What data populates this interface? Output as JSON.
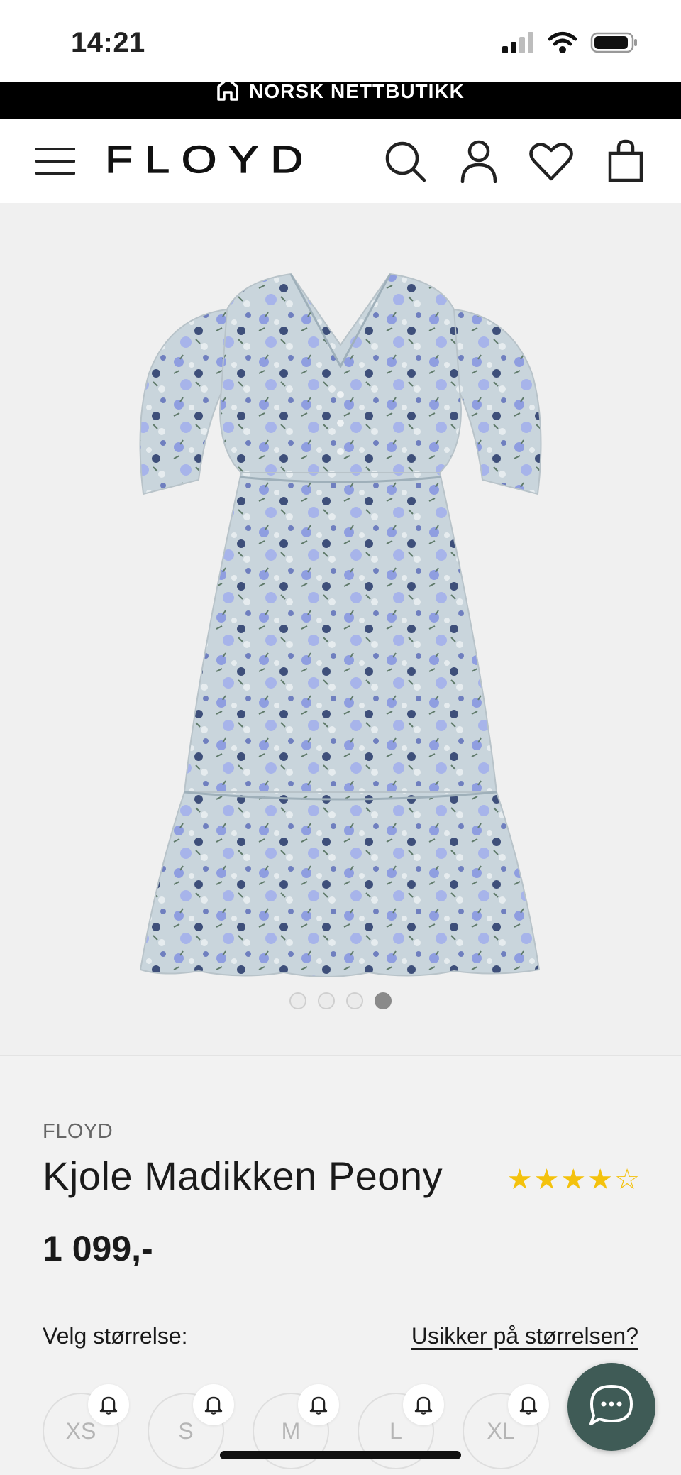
{
  "status_bar": {
    "time": "14:21",
    "icons": [
      "signal-icon",
      "wifi-icon",
      "battery-icon"
    ]
  },
  "promo": {
    "text": "NORSK NETTBUTIKK",
    "icon": "house-icon"
  },
  "header": {
    "logo_text": "FLOYD",
    "icons": [
      "menu-icon",
      "search-icon",
      "user-icon",
      "heart-icon",
      "bag-icon"
    ]
  },
  "gallery": {
    "image": "floral-dress-image",
    "slide_count": 4,
    "active_slide": 4
  },
  "product": {
    "brand": "FLOYD",
    "name": "Kjole Madikken Peony",
    "rating": 4,
    "rating_max": 5,
    "price": "1 099,-"
  },
  "size_picker": {
    "label": "Velg størrelse:",
    "help_link": "Usikker på størrelsen?",
    "sizes": [
      "XS",
      "S",
      "M",
      "L",
      "XL"
    ]
  },
  "colors": {
    "promo_bg": "#000000",
    "star": "#f4c20d",
    "chat_button": "#3f5b56",
    "page_bg": "#f2f2f2"
  }
}
